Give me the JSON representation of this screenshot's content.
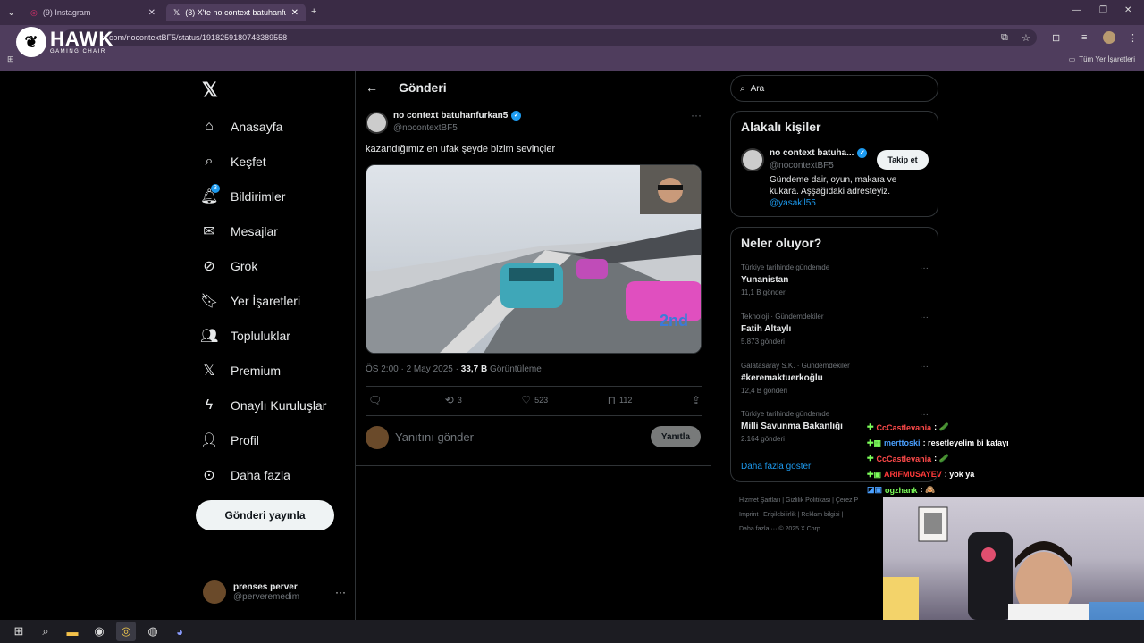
{
  "browser": {
    "tabs": [
      {
        "label": "(9) Instagram"
      },
      {
        "label": "(3) X'te no context batuhanfurk"
      }
    ],
    "url": "x.com/nocontextBF5/status/1918259180743389558",
    "bookmarks_label": "Tüm Yer İşaretleri"
  },
  "overlay_logo": {
    "brand": "HAWK",
    "sub": "GAMING CHAIR"
  },
  "nav": {
    "items": [
      {
        "label": "Anasayfa",
        "icon": "home-icon"
      },
      {
        "label": "Keşfet",
        "icon": "search-icon"
      },
      {
        "label": "Bildirimler",
        "icon": "bell-icon",
        "badge": "3"
      },
      {
        "label": "Mesajlar",
        "icon": "mail-icon"
      },
      {
        "label": "Grok",
        "icon": "grok-icon"
      },
      {
        "label": "Yer İşaretleri",
        "icon": "bookmark-icon"
      },
      {
        "label": "Topluluklar",
        "icon": "communities-icon"
      },
      {
        "label": "Premium",
        "icon": "x-icon"
      },
      {
        "label": "Onaylı Kuruluşlar",
        "icon": "lightning-icon"
      },
      {
        "label": "Profil",
        "icon": "person-icon"
      },
      {
        "label": "Daha fazla",
        "icon": "more-circle-icon"
      }
    ],
    "post_button": "Gönderi yayınla",
    "account": {
      "name": "prenses perver",
      "handle": "@perveremedim"
    }
  },
  "main": {
    "title": "Gönderi",
    "tweet": {
      "author": "no context batuhanfurkan5",
      "handle": "@nocontextBF5",
      "text": "kazandığımız en ufak şeyde bizim sevinçler",
      "time": "ÖS 2:00 · 2 May 2025 · ",
      "views": "33,7 B",
      "views_label": " Görüntüleme",
      "stats": {
        "replies": "",
        "retweets": "3",
        "likes": "523",
        "bookmarks": "112"
      }
    },
    "reply_placeholder": "Yanıtını gönder",
    "reply_button": "Yanıtla"
  },
  "right": {
    "search_placeholder": "Ara",
    "relevant": {
      "title": "Alakalı kişiler",
      "name": "no context batuha...",
      "handle": "@nocontextBF5",
      "bio": "Gündeme dair, oyun, makara ve kukara. Aşşağıdaki adresteyiz.",
      "link": "@yasakll55",
      "follow": "Takip et"
    },
    "trends": {
      "title": "Neler oluyor?",
      "items": [
        {
          "category": "Türkiye tarihinde gündemde",
          "topic": "Yunanistan",
          "count": "11,1 B gönderi"
        },
        {
          "category": "Teknoloji · Gündemdekiler",
          "topic": "Fatih Altaylı",
          "count": "5.873 gönderi"
        },
        {
          "category": "Galatasaray S.K. · Gündemdekiler",
          "topic": "#keremaktuerkoğlu",
          "count": "12,4 B gönderi"
        },
        {
          "category": "Türkiye tarihinde gündemde",
          "topic": "Milli Savunma Bakanlığı",
          "count": "2.164 gönderi"
        }
      ],
      "show_more": "Daha fazla göster"
    },
    "footer": {
      "line1": "Hizmet Şartları  |  Gizlilik Politikası  |  Çerez P",
      "line2": "Imprint  |  Erişilebilirlik  |  Reklam bilgisi  |",
      "line3": "Daha fazla ···   © 2025 X Corp."
    }
  },
  "chat": [
    {
      "user": "CcCastlevania",
      "color": "#ff4a4a",
      "msg": " : 🥒"
    },
    {
      "user": "merttoski",
      "color": "#4aa0ff",
      "msg": " : resetleyelim bi kafayı"
    },
    {
      "user": "CcCastlevania",
      "color": "#ff4a4a",
      "msg": " : 🥒"
    },
    {
      "user": "ARIFMUSAYEV",
      "color": "#ff3a3a",
      "msg": " : yok ya"
    },
    {
      "user": "ogzhank",
      "color": "#7cff5a",
      "msg": " : 🙈"
    }
  ],
  "colors": {
    "accent": "#1d9bf0",
    "background": "#000000",
    "chrome": "#4f3d5d"
  }
}
